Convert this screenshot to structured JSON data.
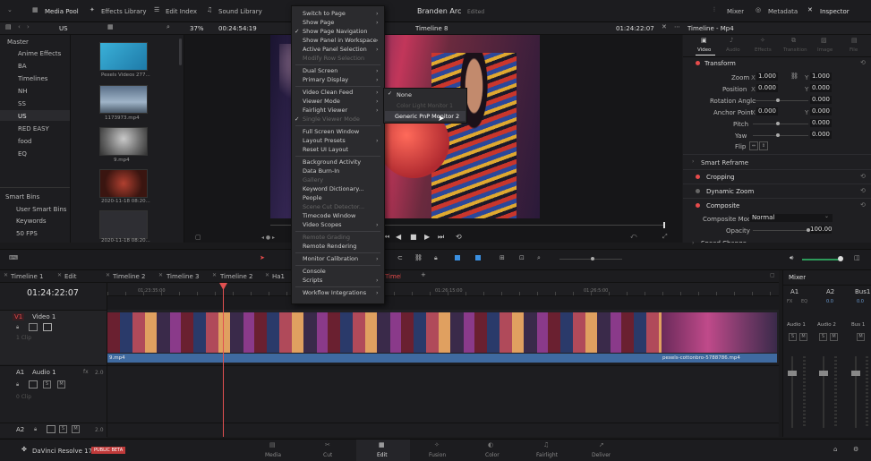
{
  "top_bar": {
    "media_pool": "Media Pool",
    "effects_library": "Effects Library",
    "edit_index": "Edit Index",
    "sound_library": "Sound Library",
    "project_title": "Branden Arc",
    "project_status": "Edited",
    "mixer": "Mixer",
    "metadata": "Metadata",
    "inspector": "Inspector"
  },
  "second_bar": {
    "bin_label": "US",
    "zoom": "37%",
    "source_timecode": "00:24:54:19",
    "timeline_name": "Timeline 8",
    "record_timecode": "01:24:22:07",
    "inspector_title": "Timeline - Mp4"
  },
  "bins": {
    "header": "Master",
    "items": [
      "Anime Effects",
      "BA",
      "Timelines",
      "NH",
      "SS",
      "US",
      "RED EASY",
      "food",
      "EQ"
    ],
    "smart_bins_header": "Smart Bins",
    "smart_items": [
      "User Smart Bins",
      "Keywords",
      "50 FPS"
    ]
  },
  "media": [
    {
      "name": "Pexels Videos 277..."
    },
    {
      "name": "1173973.mp4"
    },
    {
      "name": "9.mp4"
    },
    {
      "name": "2020-11-18 08:20..."
    },
    {
      "name": "2020-11-18 08:20..."
    }
  ],
  "menu": {
    "items": [
      {
        "label": "Switch to Page",
        "sub": true,
        "dim": false
      },
      {
        "label": "Show Page",
        "sub": true,
        "dim": false
      },
      {
        "label": "Show Page Navigation",
        "sub": false,
        "dim": false,
        "check": true
      },
      {
        "label": "Show Panel in Workspace",
        "sub": true,
        "dim": false
      },
      {
        "label": "Active Panel Selection",
        "sub": true,
        "dim": false
      },
      {
        "label": "Modify Row Selection",
        "sub": false,
        "dim": true
      },
      {
        "label": "Dual Screen",
        "sub": true,
        "dim": false
      },
      {
        "label": "Primary Display",
        "sub": true,
        "dim": false
      },
      {
        "label": "Video Clean Feed",
        "sub": true,
        "dim": false
      },
      {
        "label": "Viewer Mode",
        "sub": true,
        "dim": false
      },
      {
        "label": "Fairlight Viewer",
        "sub": true,
        "dim": false
      },
      {
        "label": "Single Viewer Mode",
        "sub": false,
        "dim": true,
        "check": true
      },
      {
        "label": "Full Screen Window",
        "sub": false,
        "dim": false
      },
      {
        "label": "Layout Presets",
        "sub": true,
        "dim": false
      },
      {
        "label": "Reset UI Layout",
        "sub": false,
        "dim": false
      },
      {
        "label": "Background Activity",
        "sub": false,
        "dim": false
      },
      {
        "label": "Data Burn-In",
        "sub": false,
        "dim": false
      },
      {
        "label": "Gallery",
        "sub": false,
        "dim": true
      },
      {
        "label": "Keyword Dictionary...",
        "sub": false,
        "dim": false
      },
      {
        "label": "People",
        "sub": false,
        "dim": false
      },
      {
        "label": "Scene Cut Detector...",
        "sub": false,
        "dim": true
      },
      {
        "label": "Timecode Window",
        "sub": false,
        "dim": false
      },
      {
        "label": "Video Scopes",
        "sub": true,
        "dim": false
      },
      {
        "label": "Remote Grading",
        "sub": false,
        "dim": true
      },
      {
        "label": "Remote Rendering",
        "sub": false,
        "dim": false
      },
      {
        "label": "Monitor Calibration",
        "sub": true,
        "dim": false
      },
      {
        "label": "Console",
        "sub": false,
        "dim": false
      },
      {
        "label": "Scripts",
        "sub": true,
        "dim": false
      },
      {
        "label": "Workflow Integrations",
        "sub": true,
        "dim": false
      }
    ]
  },
  "submenu": {
    "none": "None",
    "item2": "Color Light Monitor 1",
    "item3": "Generic PnP Monitor 2"
  },
  "inspector": {
    "tabs": [
      "Video",
      "Audio",
      "Effects",
      "Transition",
      "Image",
      "File"
    ],
    "transform": "Transform",
    "zoom_label": "Zoom",
    "zoom_x": "1.000",
    "zoom_y": "1.000",
    "position_label": "Position",
    "pos_x": "0.000",
    "pos_y": "0.000",
    "rotation_label": "Rotation Angle",
    "rotation": "0.000",
    "anchor_label": "Anchor Point",
    "anchor_x": "0.000",
    "anchor_y": "0.000",
    "pitch_label": "Pitch",
    "pitch": "0.000",
    "yaw_label": "Yaw",
    "yaw": "0.000",
    "flip_label": "Flip",
    "smart_reframe": "Smart Reframe",
    "cropping": "Cropping",
    "dynamic_zoom": "Dynamic Zoom",
    "composite": "Composite",
    "composite_mode_label": "Composite Mode",
    "composite_mode": "Normal",
    "opacity_label": "Opacity",
    "opacity": "100.00",
    "speed_change": "Speed Change"
  },
  "timeline": {
    "tabs": [
      "Timeline 1",
      "Edit",
      "Timeline 2",
      "Timeline 3",
      "Timeline 2",
      "Ha1"
    ],
    "active_tab": "Timeline 8",
    "timecode": "01:24:22:07",
    "ruler": [
      "01:23:35:00",
      "01:26:15:00",
      "01:26:5:00"
    ],
    "v1_label": "V1",
    "v1_name": "Video 1",
    "v1_clips": "1 Clip",
    "a1_label": "A1",
    "a1_name": "Audio 1",
    "a1_level": "2.0",
    "a1_clips": "0 Clip",
    "a2_label": "A2",
    "a2_level": "2.0",
    "clip1_name": "9.mp4",
    "clip2_name": "pexels-cottonbro-5788786.mp4"
  },
  "mixer": {
    "title": "Mixer",
    "strips": [
      {
        "label": "A1",
        "name": "Audio 1"
      },
      {
        "label": "A2",
        "name": "Audio 2"
      },
      {
        "label": "Bus1",
        "name": "Bus 1"
      }
    ],
    "fx_label": "FX",
    "eq": "EQ",
    "level": "0.0"
  },
  "pages": {
    "app_name": "DaVinci Resolve 17",
    "beta": "PUBLIC BETA",
    "tabs": [
      "Media",
      "Cut",
      "Edit",
      "Fusion",
      "Color",
      "Fairlight",
      "Deliver"
    ],
    "active": "Edit"
  },
  "colors": {
    "accent_red": "#e64b4b",
    "clip_blue": "#3f6aa0",
    "playhead": "#e05050",
    "menu_bg": "#2b2b2e"
  }
}
